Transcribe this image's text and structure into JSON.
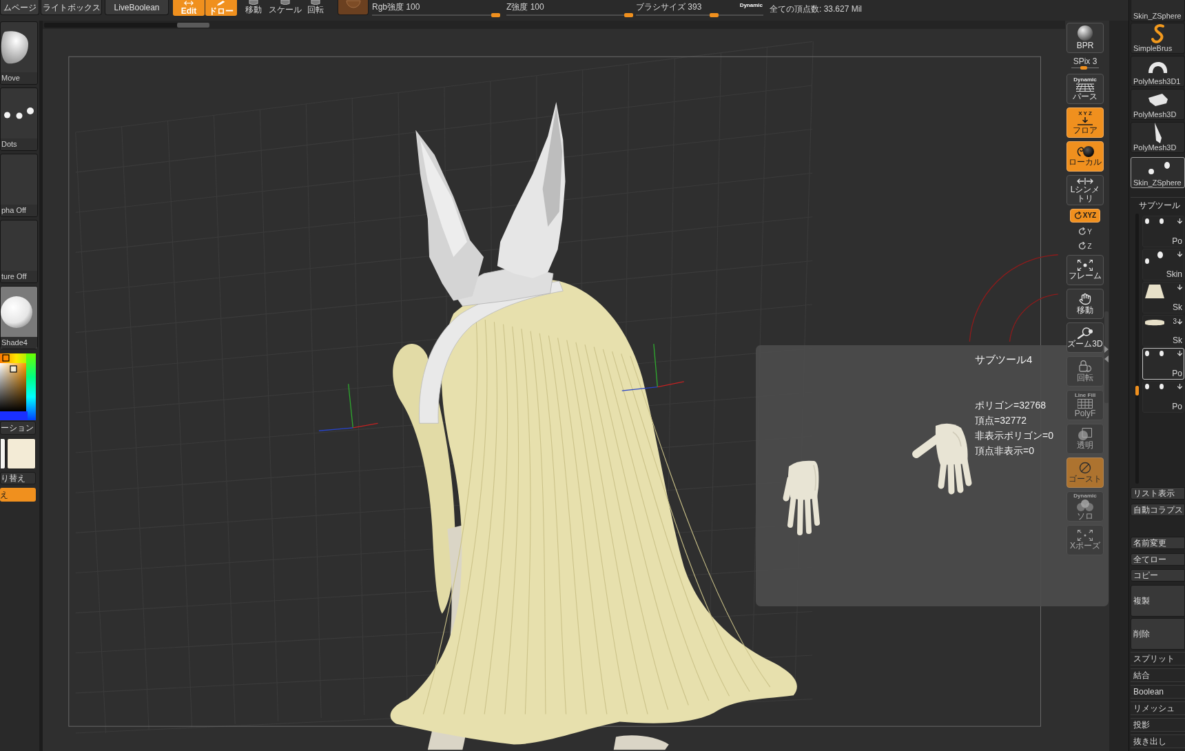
{
  "top_bar": {
    "tabs": [
      "ムページ",
      "ライトボックス",
      "LiveBoolean"
    ],
    "modes": [
      {
        "label": "Edit",
        "on": true
      },
      {
        "label": "ドロー",
        "on": true
      }
    ],
    "transform_tools": [
      {
        "label": "移動",
        "on": false
      },
      {
        "label": "スケール",
        "on": false
      },
      {
        "label": "回転",
        "on": false
      }
    ],
    "sliders": [
      {
        "label": "Rgb強度 100",
        "level": 1
      },
      {
        "label": "Z強度 100",
        "level": 1
      },
      {
        "label": "ブラシサイズ 393",
        "level": 0.62
      }
    ],
    "dynamic_toggle": "Dynamic",
    "total_points": "全ての頂点数: 33.627 Mil"
  },
  "left_shelf": {
    "thumbnails": [
      {
        "label": "Move"
      },
      {
        "label": "Dots"
      },
      {
        "label": "pha Off"
      },
      {
        "label": "ture Off"
      },
      {
        "label": "Shade4"
      }
    ],
    "gradient_button": "ーション",
    "swatches": [
      {
        "color": "#f4f4f1"
      },
      {
        "color": "#f3ebd6"
      }
    ],
    "switch_button": "り替え",
    "action_button": "え"
  },
  "canvas_toolbar": [
    {
      "kind": "button",
      "label": "BPR",
      "on": false,
      "covered": false
    },
    {
      "kind": "slider",
      "label": "SPix 3",
      "level": 0.43
    },
    {
      "kind": "button",
      "top_label": "Dynamic",
      "label": "パース",
      "on": false,
      "covered": false
    },
    {
      "kind": "button",
      "top_label": "X Y Z",
      "label": "フロア",
      "on": true,
      "covered": false
    },
    {
      "kind": "button",
      "label": "ローカル",
      "on": true,
      "covered": false
    },
    {
      "kind": "button",
      "label": "Lシンメトリ",
      "on": false,
      "covered": false
    },
    {
      "kind": "pill",
      "label": "XYZ",
      "on": true,
      "covered": false
    },
    {
      "kind": "mini",
      "label": "Y",
      "on": false,
      "covered": false
    },
    {
      "kind": "mini",
      "label": "Z",
      "on": false,
      "covered": false
    },
    {
      "kind": "button",
      "label": "フレーム",
      "on": false,
      "covered": false
    },
    {
      "kind": "button",
      "label": "移動",
      "on": false,
      "covered": false
    },
    {
      "kind": "button",
      "label": "ズーム3D",
      "on": false,
      "covered": false
    },
    {
      "kind": "button",
      "label": "回転",
      "on": false,
      "covered": true
    },
    {
      "kind": "button",
      "top_label": "Line Fill",
      "label": "PolyF",
      "on": false,
      "covered": true
    },
    {
      "kind": "button",
      "label": "透明",
      "on": false,
      "covered": true
    },
    {
      "kind": "button",
      "label": "ゴースト",
      "on": true,
      "covered": true
    },
    {
      "kind": "button",
      "top_label": "Dynamic",
      "label": "ソロ",
      "on": false,
      "covered": true
    },
    {
      "kind": "button",
      "label": "Xポーズ",
      "on": false,
      "covered": true
    }
  ],
  "popup": {
    "title": "サブツール4",
    "stats": [
      "ポリゴン=32768",
      "頂点=32772",
      "非表示ポリゴン=0",
      "頂点非表示=0"
    ]
  },
  "tool_palette": {
    "thumbnails": [
      {
        "label": "Skin_ZSphere",
        "selected": false
      },
      {
        "label": "SimpleBrus",
        "selected": false
      },
      {
        "label": "PolyMesh3D1",
        "selected": false
      },
      {
        "label": "PolyMesh3D",
        "selected": false
      },
      {
        "label": "PolyMesh3D",
        "selected": false
      },
      {
        "label": "Skin_ZSphere",
        "selected": true
      }
    ],
    "subtool": {
      "title": "サブツール",
      "items": [
        {
          "label": "Po",
          "selected": false
        },
        {
          "label": "Skin",
          "selected": false
        },
        {
          "label": "Sk",
          "selected": false
        },
        {
          "label": "Sk",
          "count": "3",
          "selected": false
        },
        {
          "label": "Po",
          "selected": true
        },
        {
          "label": "Po",
          "selected": false
        }
      ]
    },
    "view_buttons": [
      "リスト表示",
      "自動コラプス"
    ],
    "actions": [
      {
        "kind": "button",
        "label": "名前変更"
      },
      {
        "kind": "button",
        "label": "全てロー"
      },
      {
        "kind": "button",
        "label": "コピー"
      },
      {
        "kind": "tall",
        "label": "複製"
      },
      {
        "kind": "tall",
        "label": "削除"
      }
    ],
    "sections": [
      "スプリット",
      "結合",
      "Boolean",
      "リメッシュ",
      "投影",
      "抜き出し"
    ]
  }
}
